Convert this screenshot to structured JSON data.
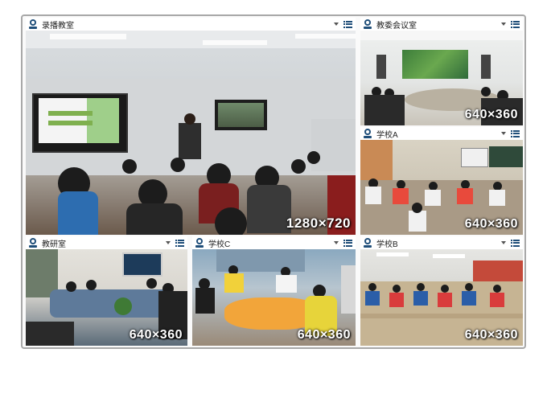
{
  "panes": [
    {
      "title": "录播教室",
      "resolution": "1280×720"
    },
    {
      "title": "教委会议室",
      "resolution": "640×360"
    },
    {
      "title": "学校A",
      "resolution": "640×360"
    },
    {
      "title": "教研室",
      "resolution": "640×360"
    },
    {
      "title": "学校C",
      "resolution": "640×360"
    },
    {
      "title": "学校B",
      "resolution": "640×360"
    }
  ],
  "icons": {
    "camera": "webcam-icon",
    "dropdown": "chevron-down-icon",
    "layout": "list-icon"
  },
  "colors": {
    "icon": "#1f4e79",
    "frame_border": "#a8a8a8"
  }
}
